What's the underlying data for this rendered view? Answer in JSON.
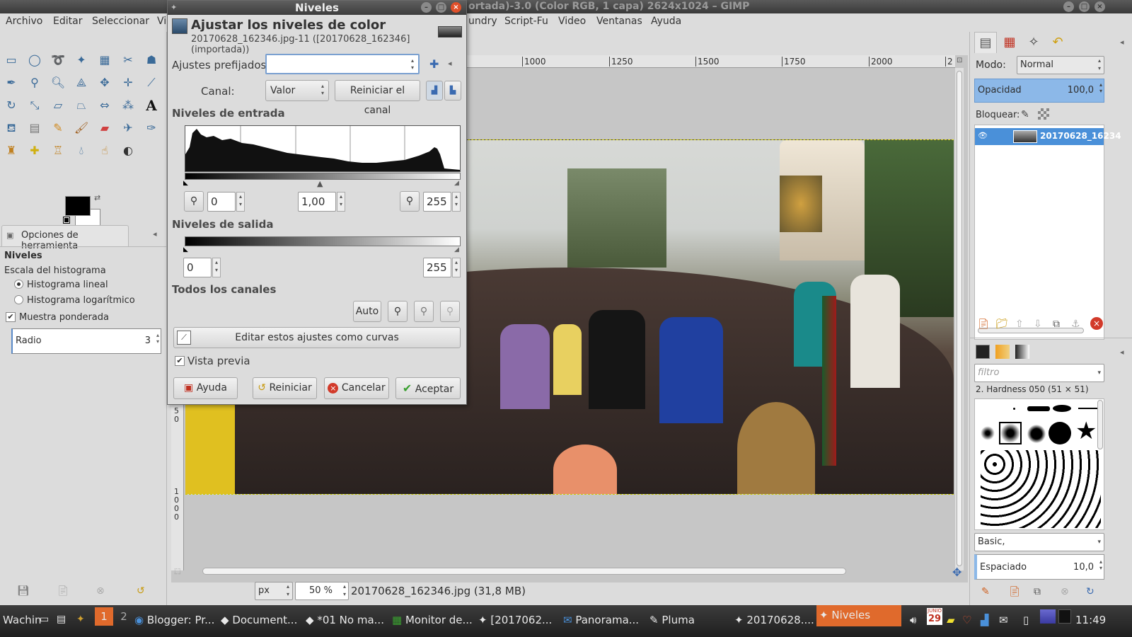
{
  "window": {
    "title": "ortada)-3.0 (Color RGB, 1 capa) 2624x1024 – GIMP"
  },
  "menubar": {
    "items": [
      "Archivo",
      "Editar",
      "Seleccionar",
      "Vi",
      "undry",
      "Script-Fu",
      "Video",
      "Ventanas",
      "Ayuda"
    ]
  },
  "toolbox": {
    "options_tab": "Opciones de herramienta",
    "tool_name": "Niveles",
    "histogram_scale_label": "Escala del histograma",
    "linear": "Histograma lineal",
    "log": "Histograma logarítmico",
    "weighted": "Muestra ponderada",
    "radius_label": "Radio",
    "radius_value": "3"
  },
  "dialog": {
    "window_title": "Niveles",
    "heading": "Ajustar los niveles de color",
    "subheading": "20170628_162346.jpg-11 ([20170628_162346] (importada))",
    "presets_label": "Ajustes prefijados:",
    "channel_label": "Canal:",
    "channel_value": "Valor",
    "reset_channel": "Reiniciar el canal",
    "input_levels": "Niveles de entrada",
    "input_low": "0",
    "input_gamma": "1,00",
    "input_high": "255",
    "output_levels": "Niveles de salida",
    "output_low": "0",
    "output_high": "255",
    "all_channels": "Todos los canales",
    "auto": "Auto",
    "edit_curves": "Editar estos ajustes como curvas",
    "preview": "Vista previa",
    "help": "Ayuda",
    "reset": "Reiniciar",
    "cancel": "Cancelar",
    "ok": "Aceptar"
  },
  "ruler": {
    "ticks": [
      "1000",
      "1250",
      "1500",
      "1750",
      "2000",
      "2"
    ]
  },
  "vruler": {
    "ticks": [
      "5",
      "0",
      "1",
      "0",
      "0",
      "0"
    ]
  },
  "statusbar": {
    "unit": "px",
    "zoom": "50 %",
    "file": "20170628_162346.jpg (31,8 MB)"
  },
  "layers": {
    "mode_label": "Modo:",
    "mode_value": "Normal",
    "opacity_label": "Opacidad",
    "opacity_value": "100,0",
    "lock_label": "Bloquear:",
    "layer_name": "20170628_16234"
  },
  "brushes": {
    "filter_placeholder": "filtro",
    "brush_name": "2. Hardness 050 (51 × 51)",
    "preset": "Basic,",
    "spacing_label": "Espaciado",
    "spacing_value": "10,0"
  },
  "taskbar": {
    "items": [
      "Wachin",
      "1",
      "2",
      "Blogger: Pr...",
      "Document...",
      "*01 No ma...",
      "Monitor de...",
      "[2017062...",
      "Panorama...",
      "Pluma",
      "20170628....",
      "Niveles"
    ],
    "calendar_month": "JUNIO",
    "calendar_day": "29",
    "clock": "11:49"
  },
  "colors": {
    "accent": "#8cb8e8",
    "active_task": "#e06a2c",
    "close_red": "#d23a2a"
  }
}
